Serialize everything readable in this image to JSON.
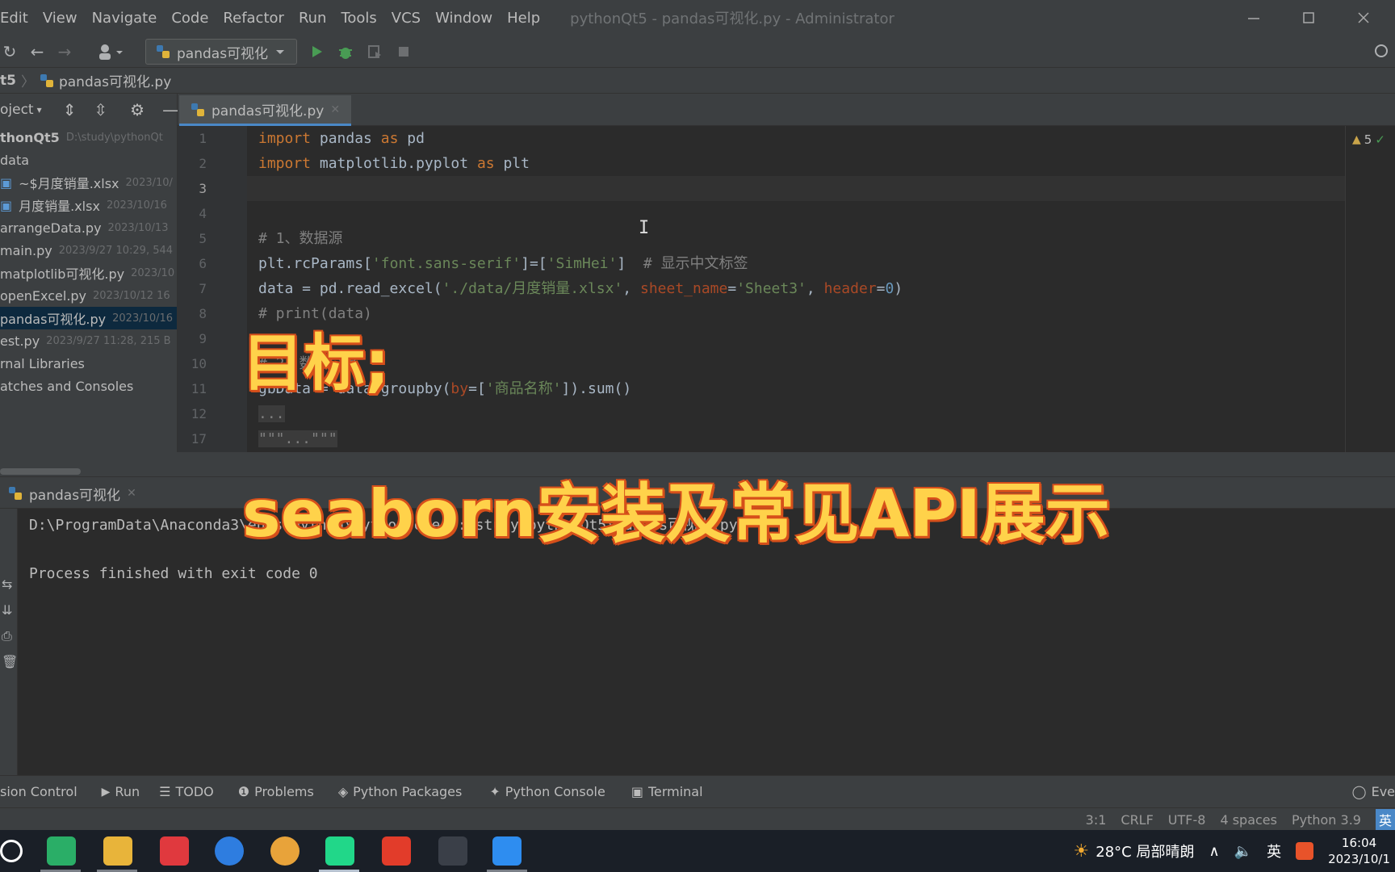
{
  "menu": {
    "items": [
      "Edit",
      "View",
      "Navigate",
      "Code",
      "Refactor",
      "Run",
      "Tools",
      "VCS",
      "Window",
      "Help"
    ],
    "window_title": "pythonQt5 - pandas可视化.py - Administrator"
  },
  "toolbar": {
    "run_config": "pandas可视化",
    "icons": [
      "back-icon",
      "forward-icon",
      "user-icon",
      "run-icon",
      "debug-icon",
      "coverage-icon",
      "stop-icon"
    ]
  },
  "breadcrumb": {
    "project": "t5",
    "file": "pandas可视化.py"
  },
  "project_panel": {
    "header": "oject",
    "tree": [
      {
        "name": "thonQt5",
        "meta": "D:\\study\\pythonQt"
      },
      {
        "name": "data",
        "meta": ""
      },
      {
        "name": "~$月度销量.xlsx",
        "meta": "2023/10/"
      },
      {
        "name": "月度销量.xlsx",
        "meta": "2023/10/16"
      },
      {
        "name": "arrangeData.py",
        "meta": "2023/10/13"
      },
      {
        "name": "main.py",
        "meta": "2023/9/27 10:29, 544"
      },
      {
        "name": "matplotlib可视化.py",
        "meta": "2023/10"
      },
      {
        "name": "openExcel.py",
        "meta": "2023/10/12 16"
      },
      {
        "name": "pandas可视化.py",
        "meta": "2023/10/16"
      },
      {
        "name": "est.py",
        "meta": "2023/9/27 11:28, 215 B"
      },
      {
        "name": "rnal Libraries",
        "meta": ""
      },
      {
        "name": "atches and Consoles",
        "meta": ""
      }
    ]
  },
  "editor": {
    "tab_label": "pandas可视化.py",
    "line_numbers": [
      "1",
      "2",
      "3",
      "4",
      "5",
      "6",
      "7",
      "8",
      "9",
      "10",
      "11",
      "12",
      "17"
    ],
    "warnings": "5",
    "code": {
      "l1_kw1": "import",
      "l1_mod": " pandas ",
      "l1_kw2": "as",
      "l1_alias": " pd",
      "l2_kw1": "import",
      "l2_mod": " matplotlib.pyplot ",
      "l2_kw2": "as",
      "l2_alias": " plt",
      "l5": "# 1、数据源",
      "l6_a": "plt.rcParams[",
      "l6_s1": "'font.sans-serif'",
      "l6_b": "]=[",
      "l6_s2": "'SimHei'",
      "l6_c": "]  ",
      "l6_cmt": "# 显示中文标签",
      "l7_a": "data = pd.read_excel(",
      "l7_s1": "'./data/月度销量.xlsx'",
      "l7_b": ", ",
      "l7_p1": "sheet_name",
      "l7_c": "=",
      "l7_s2": "'Sheet3'",
      "l7_d": ", ",
      "l7_p2": "header",
      "l7_e": "=",
      "l7_n": "0",
      "l7_f": ")",
      "l8": "# print(data)",
      "l10": "# 2、数据分组",
      "l11_a": "gbData = data.groupby(",
      "l11_p": "by",
      "l11_b": "=[",
      "l11_s": "'商品名称'",
      "l11_c": "]).sum()",
      "l12": "...",
      "l17": "\"\"\"...\"\"\""
    }
  },
  "run_panel": {
    "tab_label": "pandas可视化",
    "console": [
      "D:\\ProgramData\\Anaconda3\\envs\\python\\python.exe D:\\study\\pythonQt5\\pandas可视化.py",
      "",
      "Process finished with exit code 0"
    ]
  },
  "tool_windows": [
    {
      "label": "sion Control",
      "icon": ""
    },
    {
      "label": "Run",
      "icon": "run-icon"
    },
    {
      "label": "TODO",
      "icon": "todo-icon"
    },
    {
      "label": "Problems",
      "icon": "problems-icon"
    },
    {
      "label": "Python Packages",
      "icon": "packages-icon"
    },
    {
      "label": "Python Console",
      "icon": "console-icon"
    },
    {
      "label": "Terminal",
      "icon": "terminal-icon"
    }
  ],
  "event_log": "Eve",
  "status": {
    "position": "3:1",
    "line_sep": "CRLF",
    "encoding": "UTF-8",
    "indent": "4 spaces",
    "interpreter": "Python 3.9",
    "ime": "英"
  },
  "taskbar": {
    "weather": "28°C 局部晴朗",
    "lang": "英",
    "time": "16:04",
    "date": "2023/10/1",
    "apps": [
      "wechat-icon",
      "file-explorer-icon",
      "app-red-icon",
      "search-app-icon",
      "chrome-icon",
      "pycharm-icon",
      "wps-icon",
      "bilibili-icon",
      "app-blue-icon"
    ]
  },
  "overlay": {
    "goal": "目标;",
    "subtitle": "seaborn安装及常见API展示"
  },
  "colors": {
    "accent": "#4a88c7",
    "overlay_fill": "#ffd24a",
    "overlay_stroke": "#d64f1a"
  }
}
